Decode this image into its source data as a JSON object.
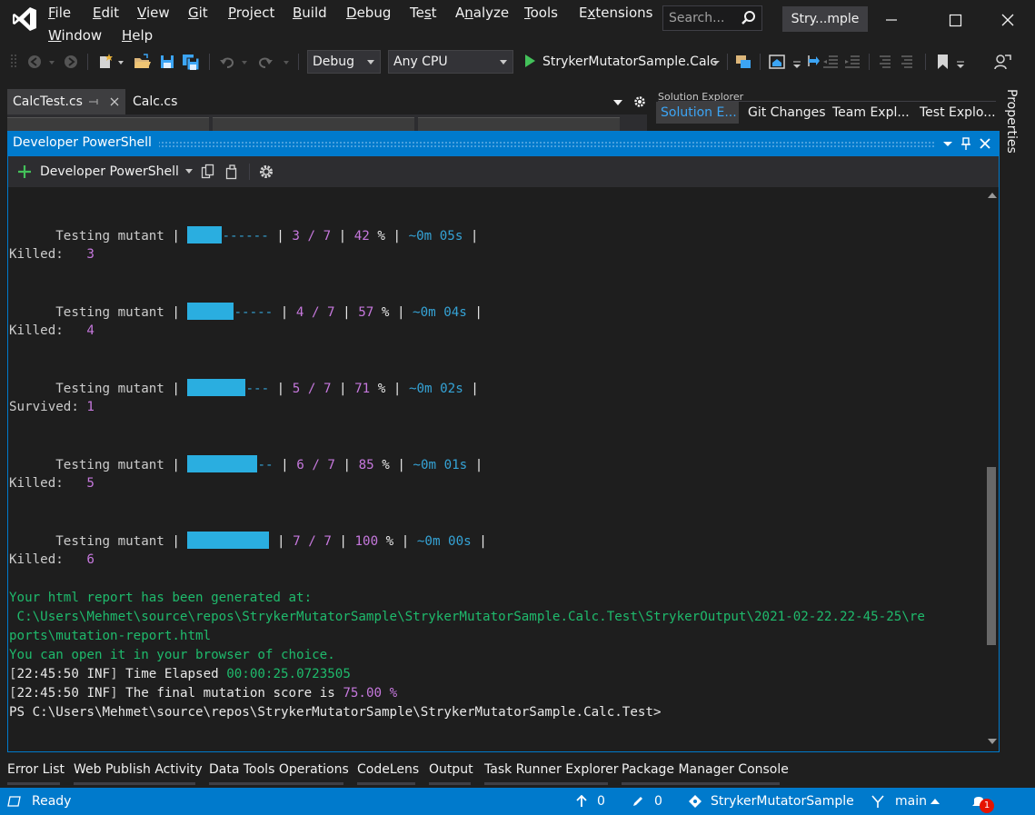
{
  "menu": {
    "row1": [
      {
        "key": "file",
        "label": "File",
        "underline": "F"
      },
      {
        "key": "edit",
        "label": "Edit",
        "underline": "E"
      },
      {
        "key": "view",
        "label": "View",
        "underline": "V"
      },
      {
        "key": "git",
        "label": "Git",
        "underline": "G"
      },
      {
        "key": "project",
        "label": "Project",
        "underline": "P"
      },
      {
        "key": "build",
        "label": "Build",
        "underline": "B"
      },
      {
        "key": "debug",
        "label": "Debug",
        "underline": "D"
      },
      {
        "key": "test",
        "label": "Test",
        "underline": "s"
      },
      {
        "key": "analyze",
        "label": "Analyze",
        "underline": "n"
      },
      {
        "key": "tools",
        "label": "Tools",
        "underline": "T"
      },
      {
        "key": "extensions",
        "label": "Extensions",
        "underline": "x"
      }
    ],
    "row2": [
      {
        "key": "window",
        "label": "Window",
        "underline": "W"
      },
      {
        "key": "help",
        "label": "Help",
        "underline": "H"
      }
    ]
  },
  "search": {
    "placeholder": "Search..."
  },
  "solution_badge": "Stry...mple",
  "toolbar": {
    "config": "Debug",
    "platform": "Any CPU",
    "startup_project": "StrykerMutatorSample.Calc"
  },
  "doc_tabs": [
    "CalcTest.cs",
    "Calc.cs"
  ],
  "right_tabs": [
    "Solution E...",
    "Git Changes",
    "Team Expl...",
    "Test Explo..."
  ],
  "right_panel_title": "Solution Explorer",
  "properties_tab": "Properties",
  "powershell": {
    "window_title": "Developer PowerShell",
    "new_terminal_label": "Developer PowerShell"
  },
  "terminal": {
    "accent_bar": "#2aaee0",
    "progress_rows": [
      {
        "label": "Testing mutant",
        "done": 3,
        "total": 7,
        "percent": "42",
        "eta": "~0m 05s",
        "fill_fraction": 0.42
      },
      {
        "label": "Testing mutant",
        "done": 4,
        "total": 7,
        "percent": "57",
        "eta": "~0m 04s",
        "fill_fraction": 0.57
      },
      {
        "label": "Testing mutant",
        "done": 5,
        "total": 7,
        "percent": "71",
        "eta": "~0m 02s",
        "fill_fraction": 0.71
      },
      {
        "label": "Testing mutant",
        "done": 6,
        "total": 7,
        "percent": "85",
        "eta": "~0m 01s",
        "fill_fraction": 0.85
      },
      {
        "label": "Testing mutant",
        "done": 7,
        "total": 7,
        "percent": "100",
        "eta": "~0m 00s",
        "fill_fraction": 1.0
      }
    ],
    "result_rows": [
      {
        "label": "Killed:",
        "count": "3"
      },
      {
        "label": "Killed:",
        "count": "4"
      },
      {
        "label": "Survived:",
        "count": "1"
      },
      {
        "label": "Killed:",
        "count": "5"
      },
      {
        "label": "Killed:",
        "count": "6"
      }
    ],
    "report_generated": "Your html report has been generated at:",
    "report_path_1": " C:\\Users\\Mehmet\\source\\repos\\StrykerMutatorSample\\StrykerMutatorSample.Calc.Test\\StrykerOutput\\2021-02-22.22-45-25\\re",
    "report_path_2": "ports\\mutation-report.html",
    "open_hint": "You can open it in your browser of choice.",
    "log1_time": "22:45:50",
    "log1_level": "INF",
    "log1_text": " Time Elapsed ",
    "log1_value": "00:00:25.0723505",
    "log2_time": "22:45:50",
    "log2_level": "INF",
    "log2_text": " The final mutation score is ",
    "log2_value": "75.00 %",
    "prompt": "PS C:\\Users\\Mehmet\\source\\repos\\StrykerMutatorSample\\StrykerMutatorSample.Calc.Test>"
  },
  "bottom_tabs": [
    "Error List",
    "Web Publish Activity",
    "Data Tools Operations",
    "CodeLens",
    "Output",
    "Task Runner Explorer",
    "Package Manager Console"
  ],
  "status": {
    "ready": "Ready",
    "up_count": "0",
    "pending_count": "0",
    "repo": "StrykerMutatorSample",
    "branch": "main",
    "notifications": "1"
  }
}
